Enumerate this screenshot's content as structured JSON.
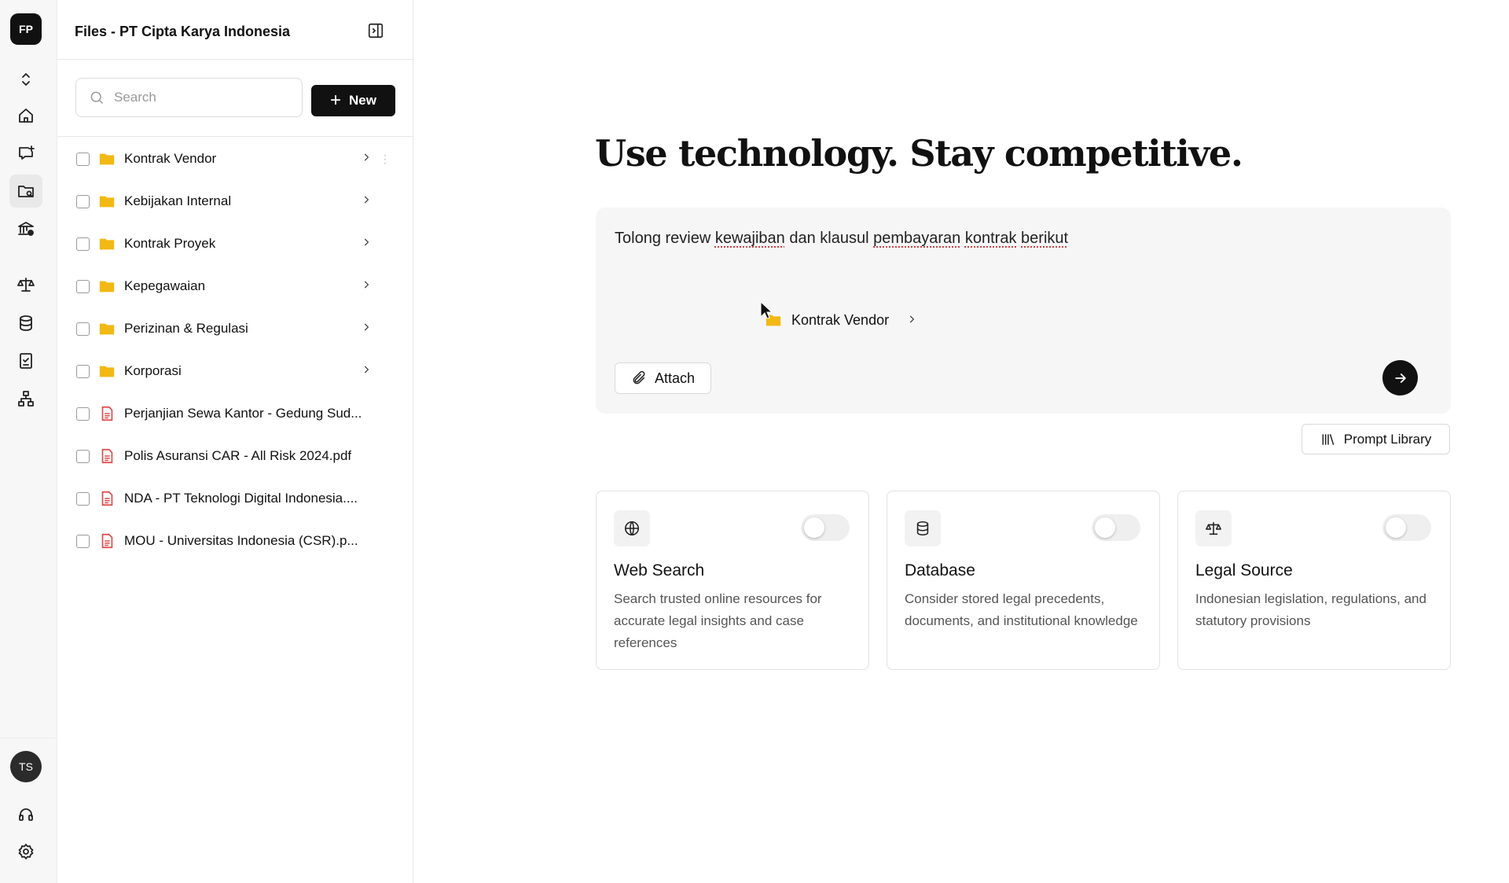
{
  "rail": {
    "logo": "FP",
    "avatar": "TS"
  },
  "panel": {
    "title": "Files - PT Cipta Karya Indonesia",
    "search_placeholder": "Search",
    "new_label": "New",
    "items": [
      {
        "name": "Kontrak Vendor",
        "type": "folder"
      },
      {
        "name": "Kebijakan Internal",
        "type": "folder"
      },
      {
        "name": "Kontrak Proyek",
        "type": "folder"
      },
      {
        "name": "Kepegawaian",
        "type": "folder"
      },
      {
        "name": "Perizinan & Regulasi",
        "type": "folder"
      },
      {
        "name": "Korporasi",
        "type": "folder"
      },
      {
        "name": "Perjanjian Sewa Kantor - Gedung Sud...",
        "type": "file"
      },
      {
        "name": "Polis Asuransi CAR - All Risk 2024.pdf",
        "type": "file"
      },
      {
        "name": "NDA - PT Teknologi Digital Indonesia....",
        "type": "file"
      },
      {
        "name": "MOU - Universitas Indonesia (CSR).p...",
        "type": "file"
      }
    ]
  },
  "main": {
    "headline": "Use technology. Stay competitive.",
    "prompt": {
      "w1": "Tolong review",
      "w2": "kewajiban",
      "w3": "dan klausul",
      "w4": "pembayaran",
      "w5": "kontrak",
      "w6": "berikut"
    },
    "drag_chip": "Kontrak Vendor",
    "attach_label": "Attach",
    "prompt_library_label": "Prompt Library",
    "cards": [
      {
        "title": "Web Search",
        "desc": "Search trusted online resources for accurate legal insights and case references",
        "icon": "globe-icon",
        "enabled": false
      },
      {
        "title": "Database",
        "desc": "Consider stored legal precedents, documents, and institutional knowledge",
        "icon": "database-icon",
        "enabled": false
      },
      {
        "title": "Legal Source",
        "desc": "Indonesian legislation, regulations, and statutory provisions",
        "icon": "scale-icon",
        "enabled": false
      }
    ]
  },
  "colors": {
    "folder": "#f2b814",
    "file": "#e04848",
    "primary": "#111111"
  }
}
